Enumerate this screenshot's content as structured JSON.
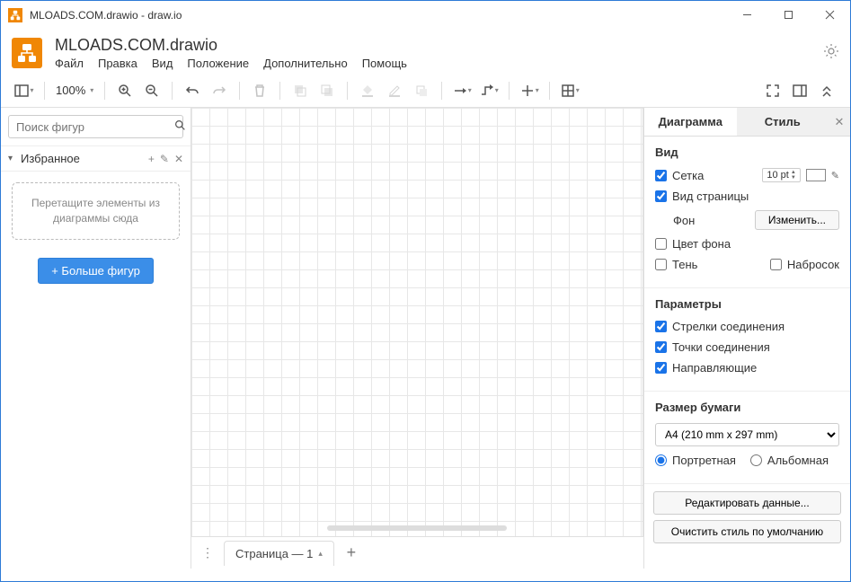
{
  "window": {
    "title": "MLOADS.COM.drawio - draw.io"
  },
  "document": {
    "title": "MLOADS.COM.drawio"
  },
  "menubar": [
    "Файл",
    "Правка",
    "Вид",
    "Положение",
    "Дополнительно",
    "Помощь"
  ],
  "toolbar": {
    "zoom": "100%"
  },
  "sidebar": {
    "search_placeholder": "Поиск фигур",
    "favorites_title": "Избранное",
    "drop_hint": "Перетащите элементы из диаграммы сюда",
    "more_shapes": "+ Больше фигур"
  },
  "tabs": {
    "page1": "Страница — 1"
  },
  "right_panel": {
    "tab_diagram": "Диаграмма",
    "tab_style": "Стиль",
    "view": {
      "title": "Вид",
      "grid": "Сетка",
      "grid_size": "10 pt",
      "page_view": "Вид страницы",
      "background": "Фон",
      "change": "Изменить...",
      "bg_color": "Цвет фона",
      "shadow": "Тень",
      "sketch": "Набросок"
    },
    "options": {
      "title": "Параметры",
      "conn_arrows": "Стрелки соединения",
      "conn_points": "Точки соединения",
      "guides": "Направляющие"
    },
    "paper": {
      "title": "Размер бумаги",
      "selected": "A4 (210 mm x 297 mm)",
      "portrait": "Портретная",
      "landscape": "Альбомная"
    },
    "edit_data": "Редактировать данные...",
    "reset_style": "Очистить стиль по умолчанию"
  }
}
